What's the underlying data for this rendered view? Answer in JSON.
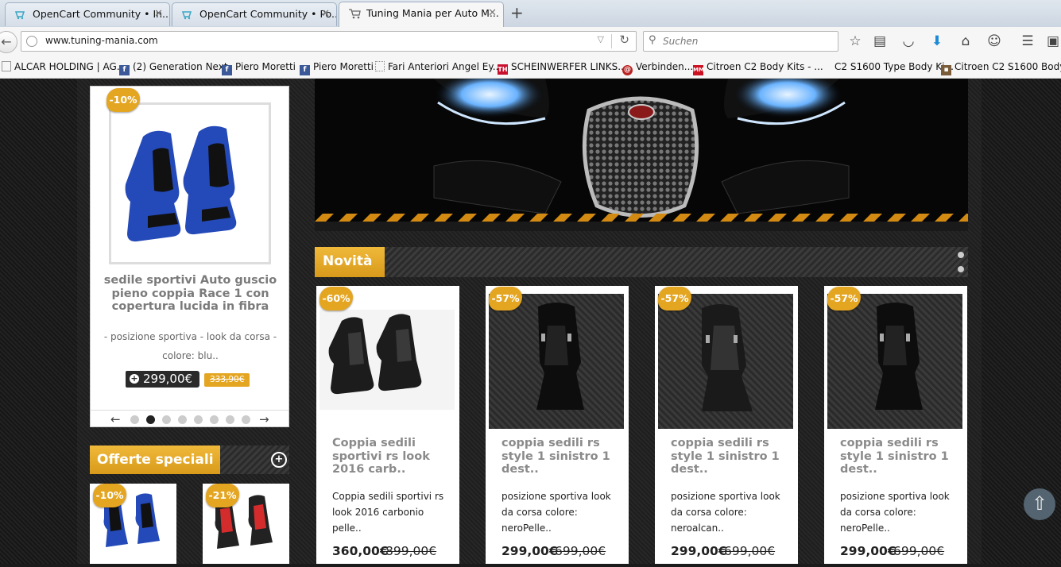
{
  "tabs": [
    {
      "title": "OpenCart Community • In...",
      "active": false
    },
    {
      "title": "OpenCart Community • Po...",
      "active": false
    },
    {
      "title": "Tuning Mania per Auto M...",
      "active": true
    }
  ],
  "navbar": {
    "url": "www.tuning-mania.com",
    "search_placeholder": "Suchen"
  },
  "bookmarks": [
    {
      "label": "ALCAR HOLDING | AG...",
      "icon": "page-icon"
    },
    {
      "label": "(2) Generation Next",
      "icon": "facebook-icon"
    },
    {
      "label": "Piero Moretti",
      "icon": "facebook-icon"
    },
    {
      "label": "Piero Moretti",
      "icon": "facebook-icon"
    },
    {
      "label": "Fari Anteriori Angel Ey...",
      "icon": "dotted-page-icon"
    },
    {
      "label": "SCHEINWERFER LINKS...",
      "icon": "th-icon"
    },
    {
      "label": "Verbinden...",
      "icon": "red-swirl-icon"
    },
    {
      "label": "Citroen C2 Body Kits - ...",
      "icon": "mm-icon"
    },
    {
      "label": "C2 S1600 Type Body Ki...",
      "icon": "none"
    },
    {
      "label": "Citroen C2 S1600 Body...",
      "icon": "shop-icon"
    }
  ],
  "slider": {
    "discount": "-10%",
    "title": "sedile sportivi Auto guscio pieno coppia Race 1 con copertura lucida in fibra",
    "description": "- posizione sportiva - look da corsa - colore: blu..",
    "price": "299,00€",
    "old_price": "333,90€",
    "active_dot": 1,
    "dot_count": 8
  },
  "offers": {
    "title": "Offerte speciali",
    "items": [
      {
        "discount": "-10%"
      },
      {
        "discount": "-21%"
      }
    ]
  },
  "novita": {
    "title": "Novità",
    "products": [
      {
        "discount": "-60%",
        "title": "Coppia sedili sportivi rs look 2016 carb..",
        "description": "Coppia sedili sportivi rs look 2016 carbonio pelle..",
        "price": "360,00€",
        "old_price": "899,00€"
      },
      {
        "discount": "-57%",
        "title": "coppia sedili rs style 1 sinistro 1 dest..",
        "description": "posizione sportiva look da corsa colore: neroPelle..",
        "price": "299,00€",
        "old_price": "699,00€"
      },
      {
        "discount": "-57%",
        "title": "coppia sedili rs style 1 sinistro 1 dest..",
        "description": "posizione sportiva look da corsa colore: neroalcan..",
        "price": "299,00€",
        "old_price": "699,00€"
      },
      {
        "discount": "-57%",
        "title": "coppia sedili rs style 1 sinistro 1 dest..",
        "description": "posizione sportiva look da corsa colore: neroPelle..",
        "price": "299,00€",
        "old_price": "699,00€"
      }
    ]
  },
  "colors": {
    "accent": "#e4a521",
    "dark": "#1e1e1e"
  }
}
